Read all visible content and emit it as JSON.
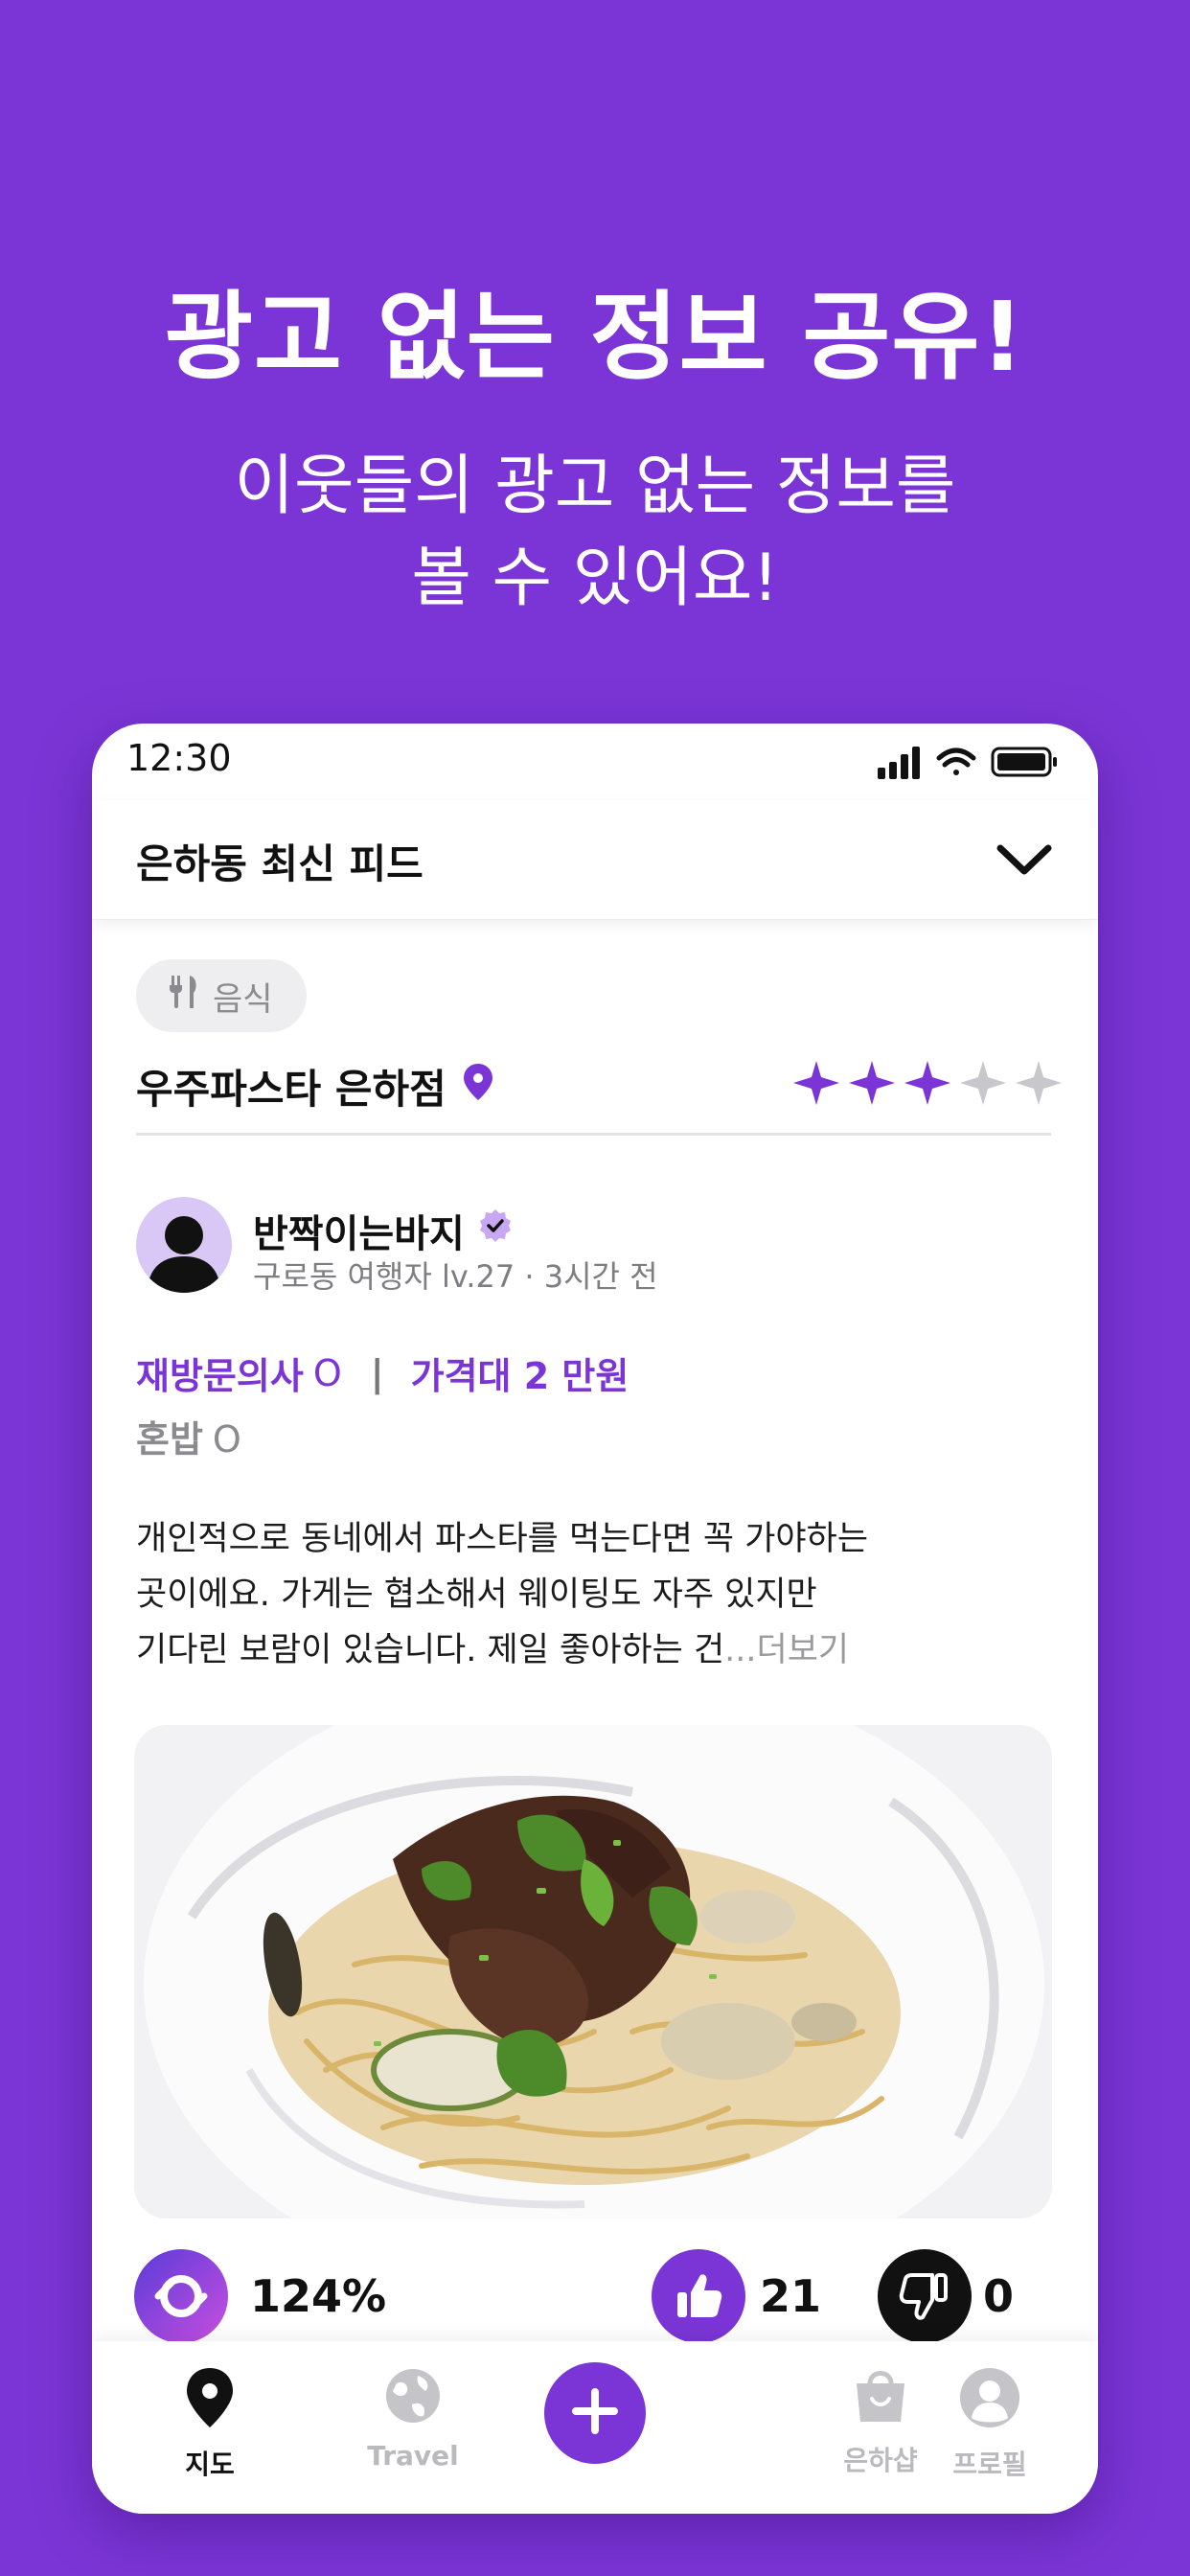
{
  "hero": {
    "title": "광고 없는 정보 공유!",
    "subtitle_line1": "이웃들의 광고 없는 정보를",
    "subtitle_line2": "볼 수 있어요!"
  },
  "status_bar": {
    "time": "12:30"
  },
  "header": {
    "title": "은하동 최신 피드"
  },
  "post": {
    "category": "음식",
    "place_name": "우주파스타 은하점",
    "rating": 3,
    "rating_max": 5,
    "author": {
      "name": "반짝이는바지",
      "meta": "구로동 여행자 lv.27 · 3시간 전"
    },
    "tags": {
      "revisit_label": "재방문의사",
      "revisit_value": "O",
      "price_label": "가격대 2 만원",
      "solo_label": "혼밥",
      "solo_value": "O"
    },
    "body_line1": "개인적으로 동네에서 파스타를 먹는다면 꼭 가야하는",
    "body_line2": "곳이에요. 가게는 협소해서 웨이팅도 자주 있지만",
    "body_line3": "기다린 보람이 있습니다. 제일 좋아하는 건",
    "more_label": "...더보기",
    "stats": {
      "score": "124%",
      "likes": "21",
      "dislikes": "0"
    }
  },
  "tab_bar": {
    "items": [
      {
        "label": "지도",
        "icon": "map-pin-icon"
      },
      {
        "label": "Travel",
        "icon": "globe-icon"
      },
      {
        "label": "",
        "icon": "plus-icon"
      },
      {
        "label": "은하샵",
        "icon": "shopping-bag-icon"
      },
      {
        "label": "프로필",
        "icon": "profile-icon"
      }
    ]
  },
  "colors": {
    "brand": "#7b35d6",
    "inactive": "#b9b9be",
    "star_empty": "#c7c7cc"
  }
}
